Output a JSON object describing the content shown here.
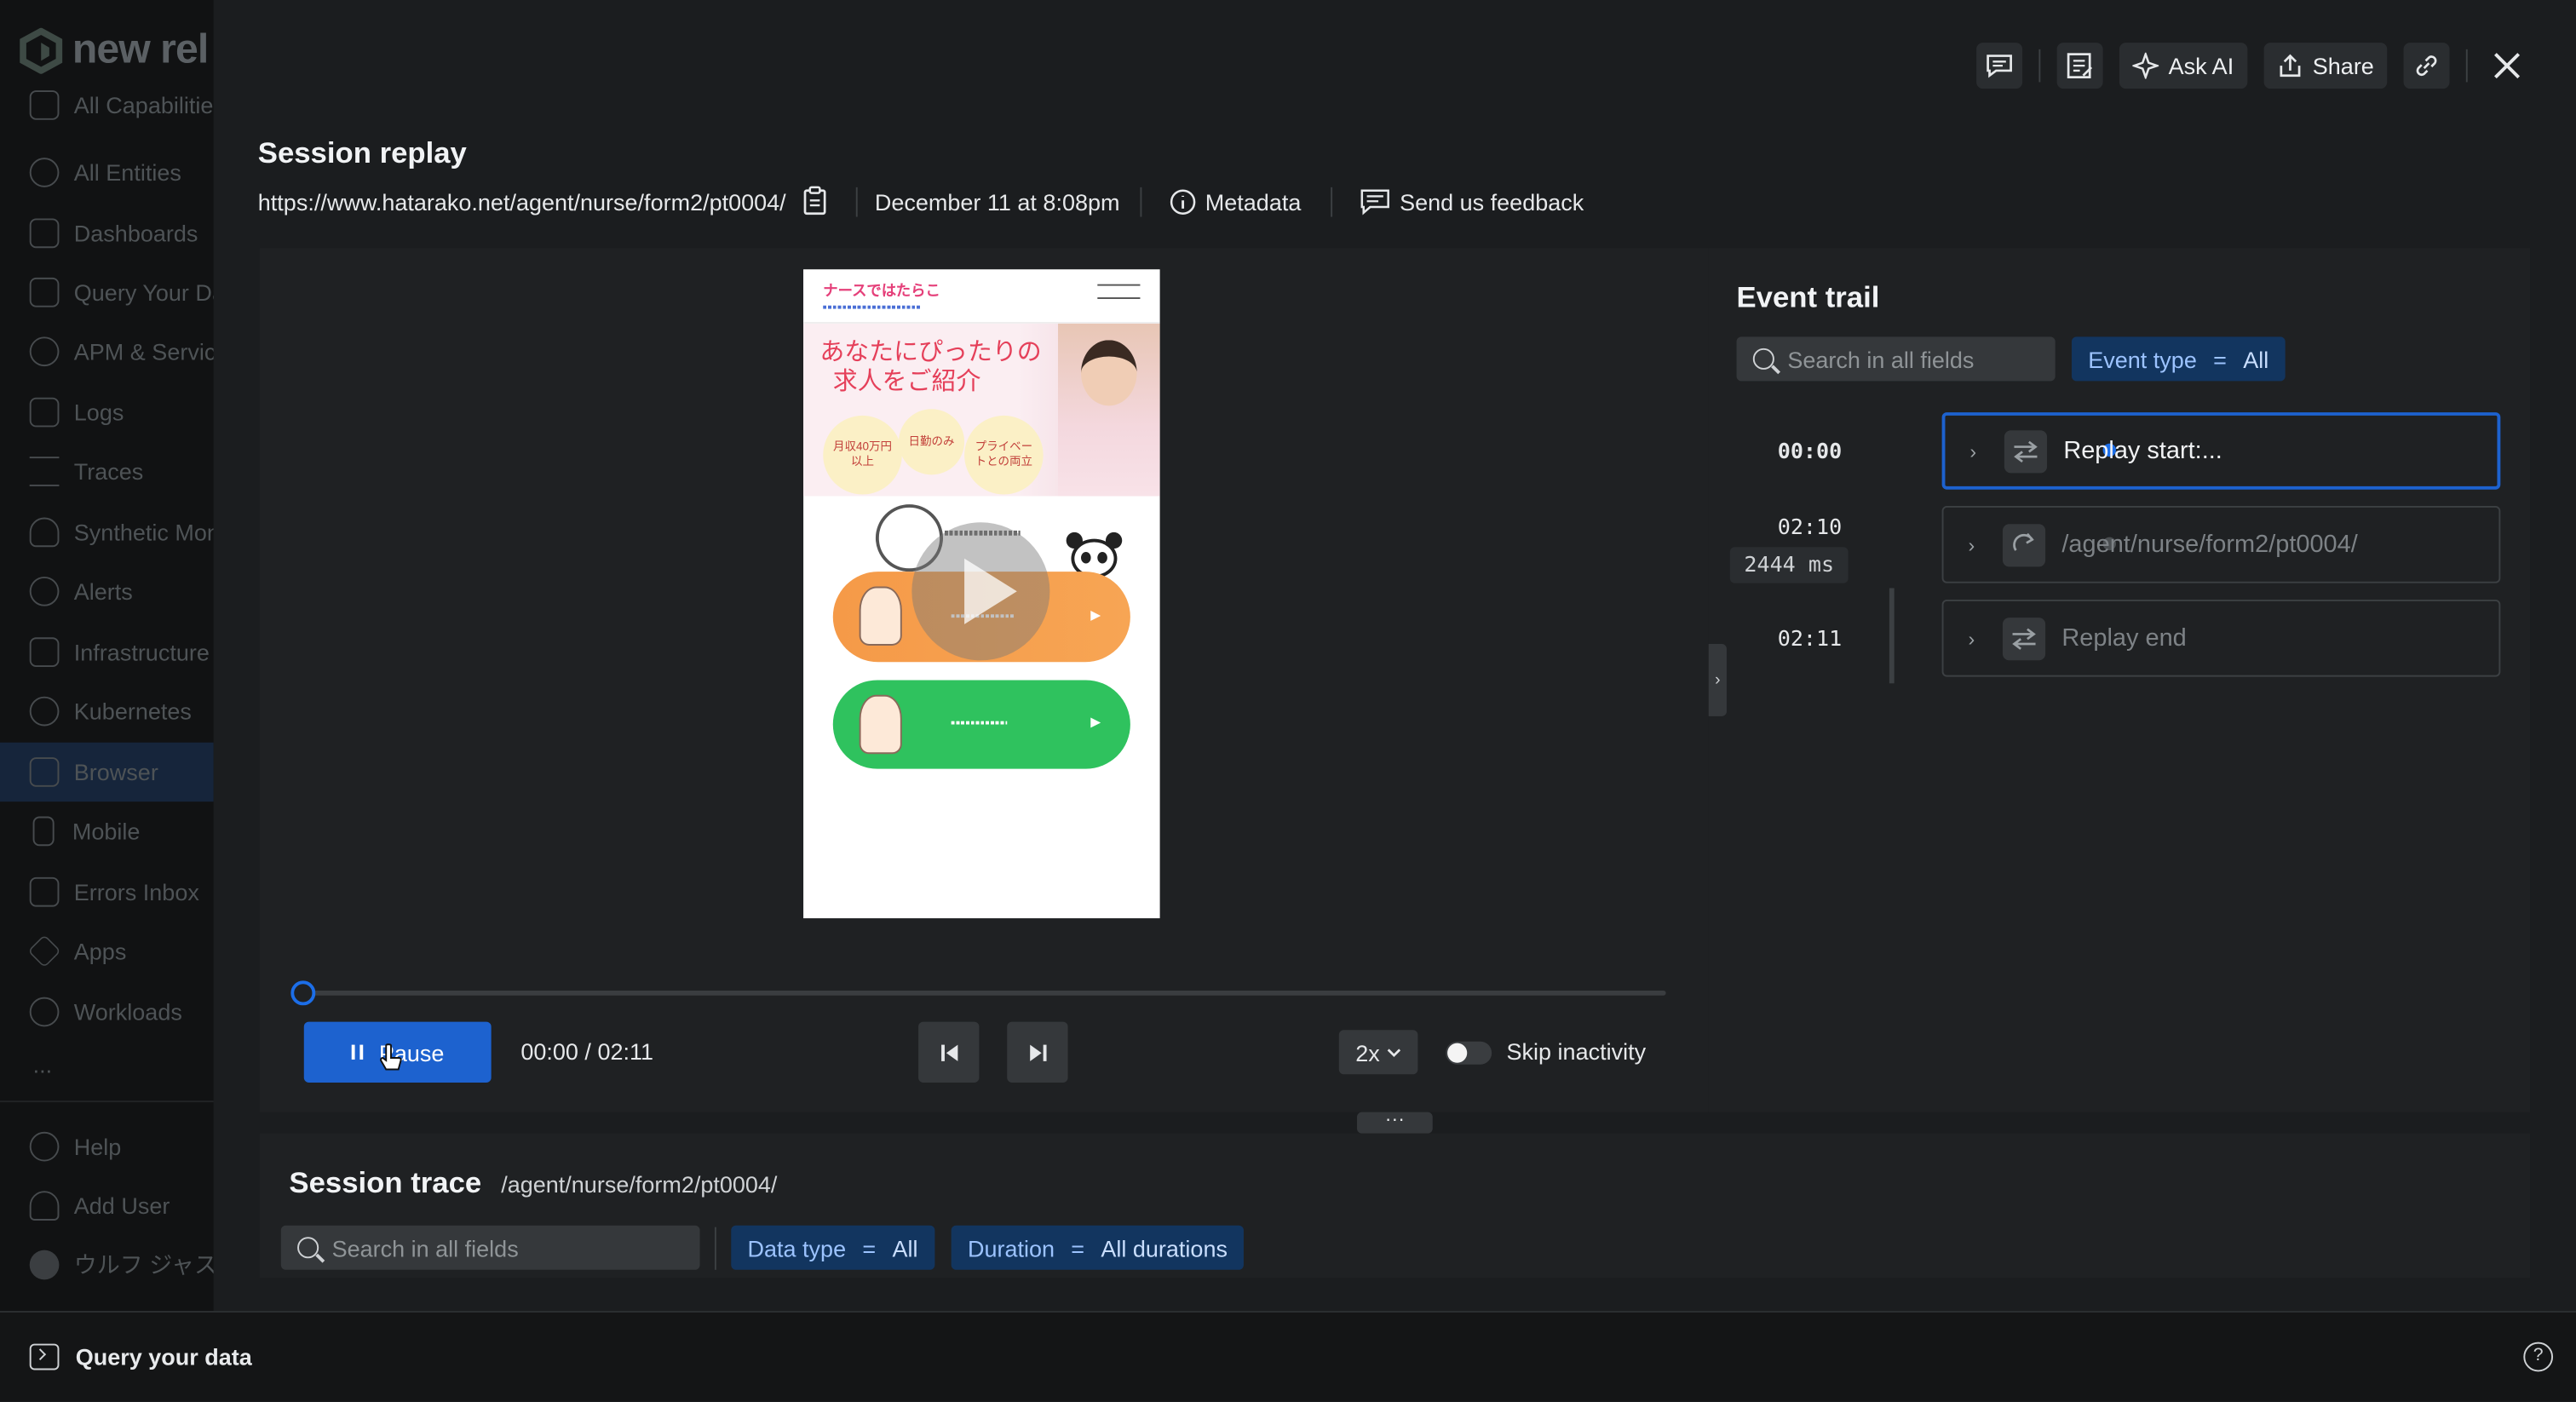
{
  "app": {
    "logo_text": "new rel"
  },
  "sidebar": {
    "items": [
      {
        "label": "All Capabilities"
      },
      {
        "label": "All Entities"
      },
      {
        "label": "Dashboards"
      },
      {
        "label": "Query Your Data"
      },
      {
        "label": "APM & Services"
      },
      {
        "label": "Logs"
      },
      {
        "label": "Traces"
      },
      {
        "label": "Synthetic Monitoring"
      },
      {
        "label": "Alerts"
      },
      {
        "label": "Infrastructure"
      },
      {
        "label": "Kubernetes"
      },
      {
        "label": "Browser"
      },
      {
        "label": "Mobile"
      },
      {
        "label": "Errors Inbox"
      },
      {
        "label": "Apps"
      },
      {
        "label": "Workloads"
      }
    ],
    "more": "...",
    "help": "Help",
    "add_user": "Add User",
    "user_name": "ウルフ ジャスティン"
  },
  "toolbar": {
    "ask_ai": "Ask AI",
    "share": "Share"
  },
  "modal": {
    "title": "Session replay",
    "url": "https://www.hatarako.net/agent/nurse/form2/pt0004/",
    "date": "December 11 at 8:08pm",
    "metadata": "Metadata",
    "feedback": "Send us feedback"
  },
  "player": {
    "pause_label": "Pause",
    "time_readout": "00:00 / 02:11",
    "speed": "2x",
    "skip_inactivity": "Skip inactivity",
    "progress": 0.0
  },
  "device_preview": {
    "brand": "ナースではたらこ",
    "headline_line1": "あなたにぴったりの",
    "headline_line2": "求人をご紹介",
    "badges": [
      "月収40万円以上",
      "日勤のみ",
      "プライベートとの両立"
    ]
  },
  "event_trail": {
    "title": "Event trail",
    "search_placeholder": "Search in all fields",
    "filter_key": "Event type",
    "filter_op": "=",
    "filter_value": "All",
    "events": [
      {
        "time": "00:00",
        "label": "Replay start:...",
        "duration": ""
      },
      {
        "time": "02:10",
        "label": "/agent/nurse/form2/pt0004/",
        "duration": "2444 ms"
      },
      {
        "time": "02:11",
        "label": "Replay end",
        "duration": ""
      }
    ]
  },
  "session_trace": {
    "title": "Session trace",
    "path": "/agent/nurse/form2/pt0004/",
    "search_placeholder": "Search in all fields",
    "filters": [
      {
        "key": "Data type",
        "op": "=",
        "value": "All"
      },
      {
        "key": "Duration",
        "op": "=",
        "value": "All durations"
      }
    ]
  },
  "bottom_bar": {
    "query_label": "Query your data",
    "help_glyph": "?"
  },
  "colors": {
    "accent": "#1d62cf",
    "chip_bg": "#12355f",
    "background": "#1b1d1f",
    "panel": "#1f2123"
  },
  "icons": [
    "comment-icon",
    "notebook-icon",
    "sparkle-icon",
    "share-icon",
    "link-icon",
    "close-icon",
    "clipboard-icon",
    "info-icon",
    "feedback-icon",
    "search-icon",
    "skip-back-icon",
    "skip-forward-icon",
    "chevron-down-icon",
    "swap-icon",
    "route-icon"
  ]
}
